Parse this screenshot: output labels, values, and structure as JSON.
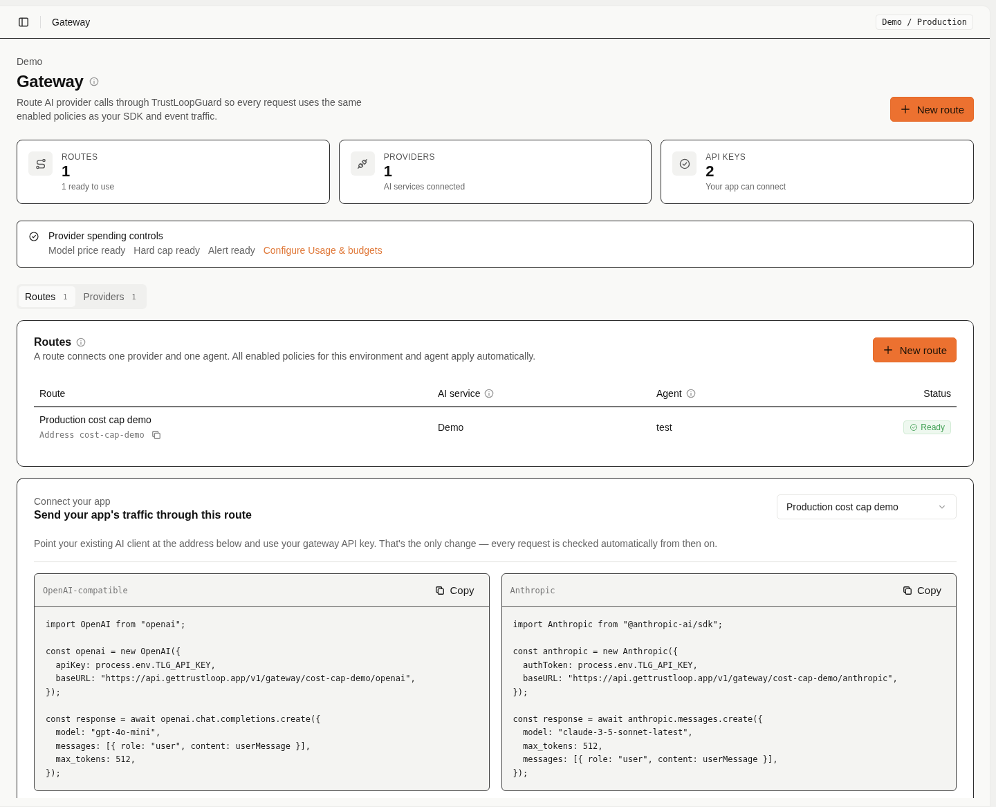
{
  "header": {
    "title": "Gateway",
    "breadcrumb": "Demo / Production"
  },
  "page": {
    "eyebrow": "Demo",
    "title": "Gateway",
    "description": "Route AI provider calls through TrustLoopGuard so every request uses the same enabled policies as your SDK and event traffic.",
    "primary_action": "New route"
  },
  "stats": [
    {
      "kind": "routes",
      "label": "ROUTES",
      "value": "1",
      "caption": "1 ready to use"
    },
    {
      "kind": "providers",
      "label": "PROVIDERS",
      "value": "1",
      "caption": "AI services connected"
    },
    {
      "kind": "api_keys",
      "label": "API KEYS",
      "value": "2",
      "caption": "Your app can connect"
    }
  ],
  "spending": {
    "title": "Provider spending controls",
    "items": [
      "Model price ready",
      "Hard cap ready",
      "Alert ready"
    ],
    "link": "Configure Usage & budgets"
  },
  "tabs": [
    {
      "label": "Routes",
      "count": "1",
      "selected": true
    },
    {
      "label": "Providers",
      "count": "1",
      "selected": false
    }
  ],
  "routes": {
    "title": "Routes",
    "description": "A route connects one provider and one agent. All enabled policies for this environment and agent apply automatically.",
    "action": "New route",
    "columns": [
      {
        "label": "Route",
        "info": false
      },
      {
        "label": "AI service",
        "info": true
      },
      {
        "label": "Agent",
        "info": true
      },
      {
        "label": "Status",
        "info": false
      }
    ],
    "rows": [
      {
        "name": "Production cost cap demo",
        "address_label": "Address",
        "address": "cost-cap-demo",
        "service": "Demo",
        "agent": "test",
        "status": "Ready"
      }
    ]
  },
  "connect": {
    "eyebrow": "Connect your app",
    "title": "Send your app's traffic through this route",
    "route_select": "Production cost cap demo",
    "description": "Point your existing AI client at the address below and use your gateway API key. That's the only change — every request is checked automatically from then on.",
    "snippets": [
      {
        "label": "OpenAI-compatible",
        "copy": "Copy",
        "code": [
          [
            "import OpenAI from \"openai\";"
          ],
          [
            "const openai = new OpenAI({",
            "  apiKey: process.env.TLG_API_KEY,",
            "  baseURL: \"https://api.gettrustloop.app/v1/gateway/cost-cap-demo/openai\",",
            "});"
          ],
          [
            "const response = await openai.chat.completions.create({",
            "  model: \"gpt-4o-mini\",",
            "  messages: [{ role: \"user\", content: userMessage }],",
            "  max_tokens: 512,",
            "});"
          ]
        ]
      },
      {
        "label": "Anthropic",
        "copy": "Copy",
        "code": [
          [
            "import Anthropic from \"@anthropic-ai/sdk\";"
          ],
          [
            "const anthropic = new Anthropic({",
            "  authToken: process.env.TLG_API_KEY,",
            "  baseURL: \"https://api.gettrustloop.app/v1/gateway/cost-cap-demo/anthropic\",",
            "});"
          ],
          [
            "const response = await anthropic.messages.create({",
            "  model: \"claude-3-5-sonnet-latest\",",
            "  max_tokens: 512,",
            "  messages: [{ role: \"user\", content: userMessage }],",
            "});"
          ]
        ]
      }
    ]
  }
}
